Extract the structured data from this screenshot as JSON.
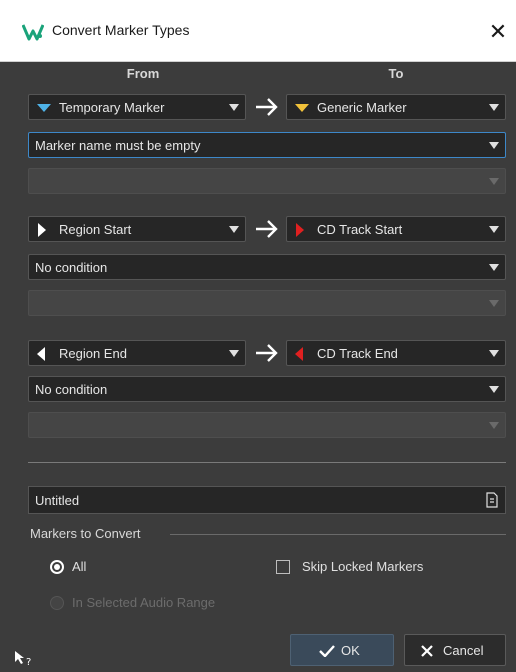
{
  "window": {
    "title": "Convert Marker Types",
    "close_glyph": "✕"
  },
  "columns": {
    "from": "From",
    "to": "To"
  },
  "rules": [
    {
      "from": {
        "label": "Temporary Marker",
        "icon": "temporary-marker-icon",
        "color": "#4fb3e8"
      },
      "to": {
        "label": "Generic Marker",
        "icon": "generic-marker-icon",
        "color": "#f2c23a"
      },
      "condition": "Marker name must be empty",
      "condition_value": ""
    },
    {
      "from": {
        "label": "Region Start",
        "icon": "region-start-icon",
        "color": "#ffffff"
      },
      "to": {
        "label": "CD Track Start",
        "icon": "cd-track-start-icon",
        "color": "#e02020"
      },
      "condition": "No condition",
      "condition_value": ""
    },
    {
      "from": {
        "label": "Region End",
        "icon": "region-end-icon",
        "color": "#ffffff"
      },
      "to": {
        "label": "CD Track End",
        "icon": "cd-track-end-icon",
        "color": "#e02020"
      },
      "condition": "No condition",
      "condition_value": ""
    }
  ],
  "preset": {
    "name": "Untitled",
    "icon": "preset-document-icon"
  },
  "markers_to_convert": {
    "label": "Markers to Convert",
    "options": [
      {
        "label": "All",
        "selected": true,
        "enabled": true
      },
      {
        "label": "In Selected Audio Range",
        "selected": false,
        "enabled": false
      }
    ],
    "skip_locked": {
      "label": "Skip Locked Markers",
      "checked": false
    }
  },
  "buttons": {
    "ok": "OK",
    "cancel": "Cancel"
  },
  "colors": {
    "accent": "#3d88c9",
    "background": "#3c3c3c",
    "field": "#262626"
  }
}
